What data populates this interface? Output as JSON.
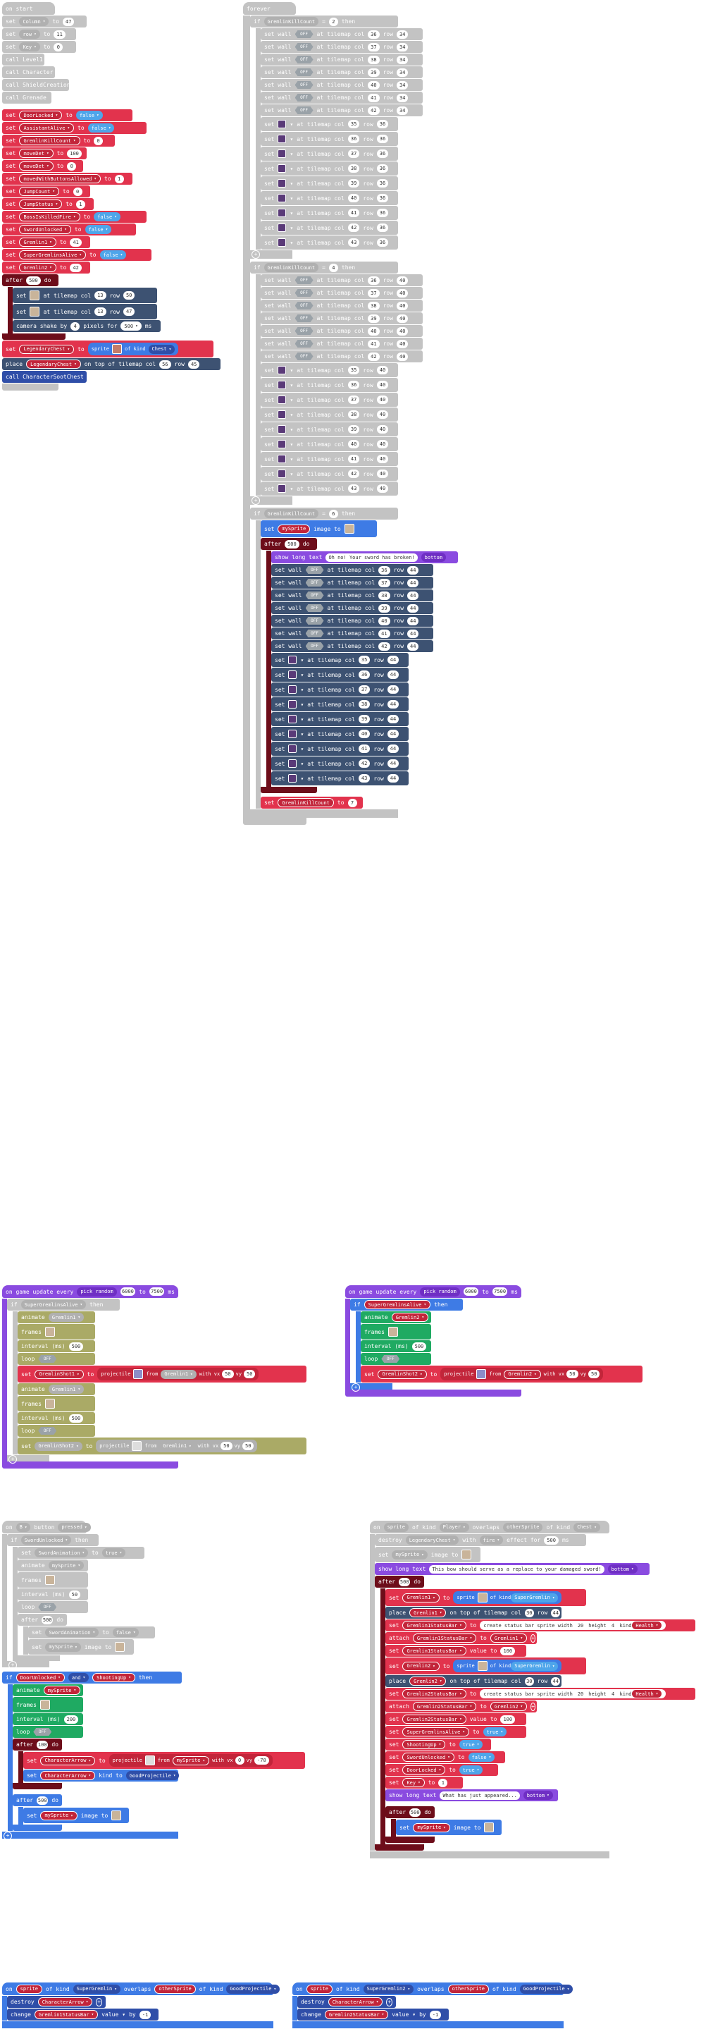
{
  "on_start": {
    "hat": "on start",
    "b1_kw": "set",
    "b1_var": "Column",
    "b1_to": "to",
    "b1_val": "47",
    "b2_kw": "set",
    "b2_var": "row",
    "b2_to": "to",
    "b2_val": "11",
    "b3_kw": "set",
    "b3_var": "Key",
    "b3_to": "to",
    "b3_val": "0",
    "call1": "call Level1",
    "call2": "call Character",
    "call3": "call ShieldCreation",
    "call4": "call Grenade",
    "vars": [
      {
        "name": "DoorLocked",
        "kind": "drop",
        "val": "false"
      },
      {
        "name": "AssistantAlive",
        "kind": "drop",
        "val": "false"
      },
      {
        "name": "GremlinKillCount",
        "kind": "pill",
        "val": "0"
      },
      {
        "name": "moveDet",
        "kind": "pill",
        "val": "100"
      },
      {
        "name": "moveDet",
        "kind": "pill",
        "val": "0"
      },
      {
        "name": "movedWithButtonsAllowed",
        "kind": "pill",
        "val": "1"
      },
      {
        "name": "JumpCount",
        "kind": "pill",
        "val": "0"
      },
      {
        "name": "JumpStatus",
        "kind": "pill",
        "val": "1"
      },
      {
        "name": "BossIsKilledFire",
        "kind": "drop",
        "val": "false"
      },
      {
        "name": "SwordUnlocked",
        "kind": "drop",
        "val": "false"
      },
      {
        "name": "Gremlin1",
        "kind": "pill",
        "val": "41"
      },
      {
        "name": "SuperGremlinsAlive",
        "kind": "drop",
        "val": "false"
      },
      {
        "name": "Gremlin2",
        "kind": "pill",
        "val": "42"
      }
    ],
    "after_kw": "after",
    "after_ms": "500",
    "after_do": "do",
    "tile1": {
      "kw": "set",
      "at": "at",
      "tilemap": "tilemap col",
      "col": "13",
      "row_kw": "row",
      "row": "50"
    },
    "tile2": {
      "kw": "set",
      "at": "at",
      "tilemap": "tilemap col",
      "col": "13",
      "row_kw": "row",
      "row": "47"
    },
    "shake": {
      "text": "camera shake by",
      "amt": "4",
      "pixels": "pixels for",
      "ms": "500",
      "unit": "ms"
    },
    "legend": {
      "kw": "set",
      "var": "LegendaryChest",
      "to": "to",
      "sprite": "sprite",
      "of_kind": "of kind",
      "kind": "Chest"
    },
    "place": {
      "kw": "place",
      "var": "LegendaryChest",
      "on_top": "on top of",
      "tilemap": "tilemap col",
      "col": "56",
      "row_kw": "row",
      "row": "45"
    },
    "call5": "call CharacterSootChest"
  },
  "forever": {
    "hat": "forever",
    "if_kw": "if",
    "then": "then",
    "cond_var": "GremlinKillCount",
    "cond_op": "=",
    "cond_val1": "2",
    "cond_val2": "4",
    "cond_val3": "6",
    "wall": {
      "kw": "set wall",
      "state": "OFF",
      "at": "at",
      "tilemap": "tilemap col",
      "row_kw": "row"
    },
    "group1_cols": [
      "36",
      "37",
      "38",
      "39",
      "40",
      "41",
      "42"
    ],
    "group1_row": "34",
    "group1_tile_cols": [
      "35",
      "36",
      "37",
      "38",
      "39",
      "40",
      "41",
      "42",
      "43"
    ],
    "group1_tile_row": "36",
    "group2_cols": [
      "36",
      "37",
      "38",
      "39",
      "40",
      "41",
      "42"
    ],
    "group2_row": "40",
    "group2_tile_cols": [
      "35",
      "36",
      "37",
      "38",
      "39",
      "40",
      "41",
      "42",
      "43"
    ],
    "group2_tile_row": "40",
    "group3_cols": [
      "36",
      "37",
      "38",
      "39",
      "40",
      "41",
      "42"
    ],
    "group3_row": "44",
    "group3_tile_cols": [
      "35",
      "36",
      "37",
      "38",
      "39",
      "40",
      "41",
      "42",
      "43"
    ],
    "group3_tile_row": "44",
    "sprite_kw": "set",
    "sprite_var": "mySprite",
    "image_to": "image to",
    "after_kw": "after",
    "after_ms": "500",
    "after_do": "do",
    "long_text": "show long text",
    "long_msg": "Oh no! Your sword has broken!",
    "long_pos": "bottom",
    "final_kw": "set",
    "final_var": "GremlinKillCount",
    "final_to": "to",
    "final_val": "7"
  },
  "update1": {
    "hat_a": "on game update every",
    "hat_b": "pick random",
    "min": "6000",
    "to": "to",
    "max": "7500",
    "unit": "ms",
    "if_kw": "if",
    "cond": "SuperGremlinsAlive",
    "then": "then",
    "anim": "animate",
    "anim_var": "Gremlin1",
    "frames": "frames",
    "interval": "interval (ms)",
    "interval_val": "500",
    "loop": "loop",
    "loop_val": "OFF",
    "set_kw": "set",
    "shot": "GremlinShot1",
    "to_kw": "to",
    "proj": "projectile",
    "from": "from",
    "from_var": "Gremlin1",
    "vx_kw": "with vx",
    "vx": "50",
    "vy_kw": "vy",
    "vy": "50",
    "anim2_var": "Gremlin1",
    "shot2": "GremlinShot2",
    "from2_var": "Gremlin1",
    "vx2": "50",
    "vy2": "50"
  },
  "update2": {
    "hat_a": "on game update every",
    "hat_b": "pick random",
    "min": "6000",
    "to": "to",
    "max": "7500",
    "unit": "ms",
    "if_kw": "if",
    "cond": "SuperGremlinsAlive",
    "then": "then",
    "anim": "animate",
    "anim_var": "Gremlin2",
    "frames": "frames",
    "interval": "interval (ms)",
    "interval_val": "500",
    "loop": "loop",
    "loop_val": "OFF",
    "set_kw": "set",
    "shot": "GremlinShot2",
    "to_kw": "to",
    "proj": "projectile",
    "from": "from",
    "from_var": "Gremlin2",
    "vx_kw": "with vx",
    "vx": "50",
    "vy_kw": "vy",
    "vy": "50"
  },
  "button": {
    "hat": "on",
    "btn": "B",
    "event": "button",
    "ev2": "pressed",
    "if1": "if",
    "cond1": "SwordUnlocked",
    "then": "then",
    "set1": "set",
    "var1": "SwordAnimation",
    "to": "to",
    "val1": "true",
    "anim": "animate",
    "anim_var": "mySprite",
    "frames": "frames",
    "interval": "interval (ms)",
    "int1": "50",
    "loop": "loop",
    "loop_val": "OFF",
    "after": "after",
    "after_ms": "500",
    "do": "do",
    "set2_var": "SwordAnimation",
    "set2_val": "false",
    "img_var": "mySprite",
    "img_to": "image to",
    "if2": "if",
    "c2a": "DoorUnlocked",
    "and": "and",
    "c2b": "ShootingUp",
    "int2": "200",
    "after2": "100",
    "proj_var": "CharacterArrow",
    "proj": "projectile",
    "from": "from",
    "from_var": "mySprite",
    "vx_kw": "with vx",
    "vx": "0",
    "vy_kw": "vy",
    "vy": "-70",
    "kind_var": "CharacterArrow",
    "kind_to": "kind to",
    "kind": "GoodProjectile",
    "after3": "500",
    "img2_var": "mySprite"
  },
  "overlap": {
    "hat": "on",
    "sprite": "sprite",
    "of_kind": "of kind",
    "kind1": "Player",
    "overlaps": "overlaps",
    "other": "otherSprite",
    "kind2": "Chest",
    "destroy": "destroy",
    "d_var": "LegendaryChest",
    "d_with": "with",
    "d_eff": "fire",
    "d_eff2": "effect for",
    "d_ms": "500",
    "d_unit": "ms",
    "img_var": "mySprite",
    "img_to": "image to",
    "long": "show long text",
    "long_msg": "This bow should serve as a replace to your damaged sword!",
    "long_pos": "bottom",
    "after": "after",
    "after_ms": "500",
    "do": "do",
    "g1": "Gremlin1",
    "g2": "Gremlin2",
    "kind_sg": "SuperGremlin",
    "place": "place",
    "on_top": "on top of",
    "tilemap": "tilemap col",
    "col": "30",
    "row_kw": "row",
    "row": "44",
    "bar1": "Gremlin1StatusBar",
    "bar2": "Gremlin2StatusBar",
    "csb": "create status bar sprite width",
    "w": "20",
    "height": "height",
    "h": "4",
    "kind_kw": "kind",
    "health": "Health",
    "attach": "attach",
    "value": "value",
    "v100": "100",
    "sga": "SuperGremlinsAlive",
    "vtrue": "true",
    "shoot": "ShootingUp",
    "sword": "SwordUnlocked",
    "vfalse": "false",
    "door": "DoorLocked",
    "key": "Key",
    "one": "1",
    "long2_msg": "What has just appeared...",
    "after2": "500"
  },
  "bottom1": {
    "hat": "on",
    "s": "sprite",
    "ok": "of kind",
    "k1": "SuperGremlin",
    "ov": "overlaps",
    "other": "otherSprite",
    "k2": "GoodProjectile",
    "destroy": "destroy",
    "dvar": "CharacterArrow",
    "change": "change",
    "cvar": "Gremlin1StatusBar",
    "value": "value",
    "by": "by",
    "n": "-1"
  },
  "bottom2": {
    "hat": "on",
    "s": "sprite",
    "ok": "of kind",
    "k1": "SuperGremlin2",
    "ov": "overlaps",
    "other": "otherSprite",
    "k2": "GoodProjectile",
    "destroy": "destroy",
    "dvar": "CharacterArrow",
    "change": "change",
    "cvar": "Gremlin2StatusBar",
    "value": "value",
    "by": "by",
    "n": "-1"
  }
}
